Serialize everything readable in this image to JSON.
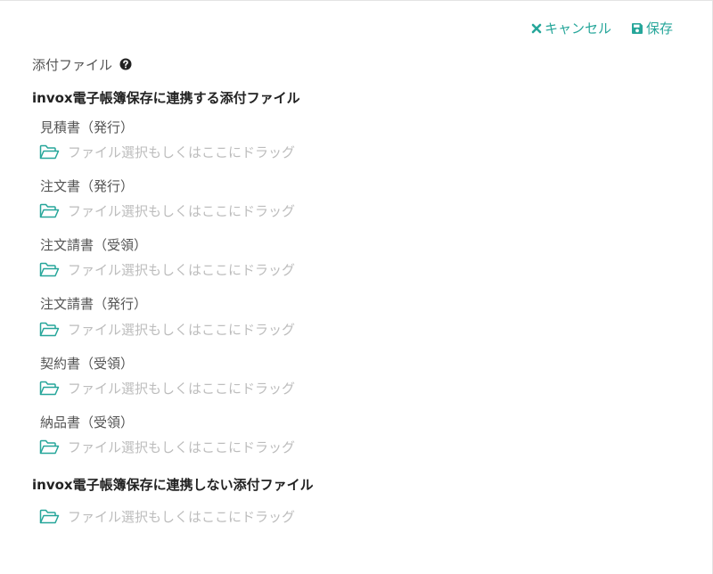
{
  "toolbar": {
    "cancel_label": "キャンセル",
    "save_label": "保存",
    "accent_color": "#26a69a"
  },
  "field": {
    "label": "添付ファイル",
    "help_icon": "question-circle-icon"
  },
  "linked_section": {
    "title": "invox電子帳簿保存に連携する添付ファイル",
    "items": [
      {
        "label": "見積書（発行）",
        "placeholder": "ファイル選択もしくはここにドラッグ"
      },
      {
        "label": "注文書（発行）",
        "placeholder": "ファイル選択もしくはここにドラッグ"
      },
      {
        "label": "注文請書（受領）",
        "placeholder": "ファイル選択もしくはここにドラッグ"
      },
      {
        "label": "注文請書（発行）",
        "placeholder": "ファイル選択もしくはここにドラッグ"
      },
      {
        "label": "契約書（受領）",
        "placeholder": "ファイル選択もしくはここにドラッグ"
      },
      {
        "label": "納品書（受領）",
        "placeholder": "ファイル選択もしくはここにドラッグ"
      }
    ]
  },
  "unlinked_section": {
    "title": "invox電子帳簿保存に連携しない添付ファイル",
    "placeholder": "ファイル選択もしくはここにドラッグ"
  },
  "icons": {
    "folder": "folder-open-icon",
    "cancel": "close-icon",
    "save": "floppy-disk-icon"
  }
}
